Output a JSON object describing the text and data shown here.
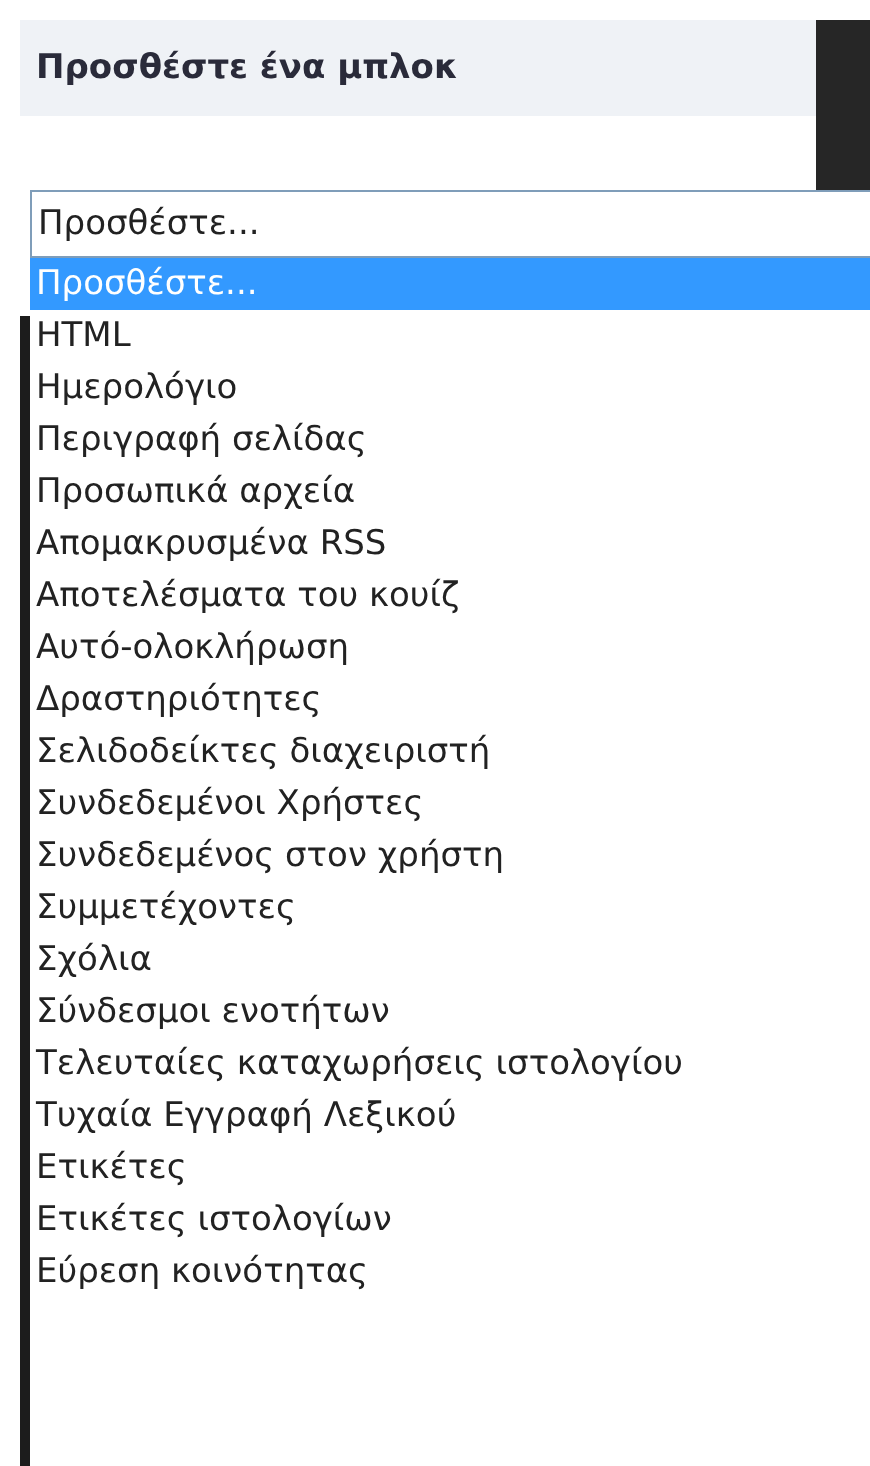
{
  "block": {
    "title": "Προσθέστε ένα μπλοκ"
  },
  "select": {
    "value": "Προσθέστε..."
  },
  "options": [
    {
      "label": "Προσθέστε...",
      "selected": true
    },
    {
      "label": "HTML",
      "selected": false
    },
    {
      "label": "Ημερολόγιο",
      "selected": false
    },
    {
      "label": "Περιγραφή σελίδας",
      "selected": false
    },
    {
      "label": "Προσωπικά αρχεία",
      "selected": false
    },
    {
      "label": "Απομακρυσμένα RSS",
      "selected": false
    },
    {
      "label": "Αποτελέσματα του κουίζ",
      "selected": false
    },
    {
      "label": "Αυτό-ολοκλήρωση",
      "selected": false
    },
    {
      "label": "Δραστηριότητες",
      "selected": false
    },
    {
      "label": "Σελιδοδείκτες διαχειριστή",
      "selected": false
    },
    {
      "label": "Συνδεδεμένοι Χρήστες",
      "selected": false
    },
    {
      "label": "Συνδεδεμένος στον χρήστη",
      "selected": false
    },
    {
      "label": "Συμμετέχοντες",
      "selected": false
    },
    {
      "label": "Σχόλια",
      "selected": false
    },
    {
      "label": "Σύνδεσμοι ενοτήτων",
      "selected": false
    },
    {
      "label": "Τελευταίες καταχωρήσεις ιστολογίου",
      "selected": false
    },
    {
      "label": "Τυχαία Εγγραφή Λεξικού",
      "selected": false
    },
    {
      "label": "Ετικέτες",
      "selected": false
    },
    {
      "label": "Ετικέτες ιστολογίων",
      "selected": false
    },
    {
      "label": "Εύρεση κοινότητας",
      "selected": false
    }
  ]
}
